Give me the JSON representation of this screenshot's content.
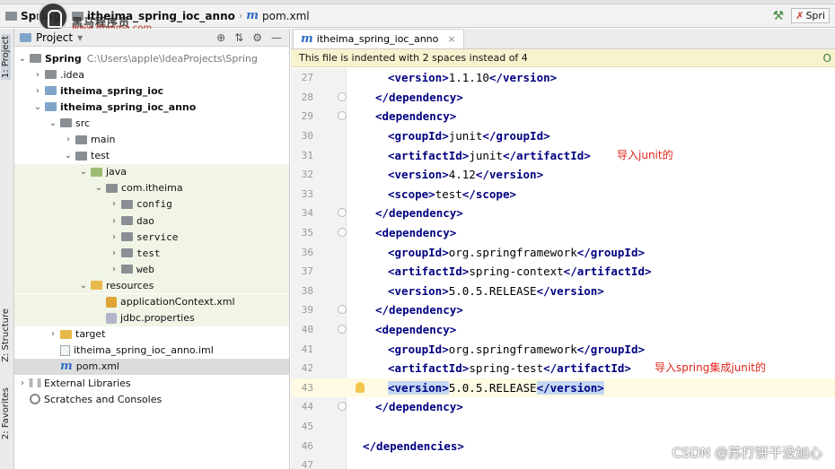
{
  "breadcrumb": {
    "items": [
      "Spring",
      "itheima_spring_ioc_anno",
      "pom.xml"
    ]
  },
  "logo": {
    "name": "黑马程序员",
    "url": "www.itheima.com"
  },
  "run_config": {
    "label": "Spri"
  },
  "left_strip": {
    "tabs": [
      "1: Project",
      "Z: Structure",
      "2: Favorites"
    ]
  },
  "project_panel": {
    "title": "Project",
    "tree": [
      {
        "label": "Spring",
        "extra": "C:\\Users\\apple\\IdeaProjects\\Spring",
        "bold": true,
        "depth": 0,
        "expanded": true,
        "icon": "folder-icon"
      },
      {
        "label": ".idea",
        "depth": 1,
        "expanded": false,
        "icon": "folder-icon"
      },
      {
        "label": "itheima_spring_ioc",
        "bold": true,
        "depth": 1,
        "expanded": false,
        "icon": "module-folder-icon"
      },
      {
        "label": "itheima_spring_ioc_anno",
        "bold": true,
        "depth": 1,
        "expanded": true,
        "icon": "module-folder-icon"
      },
      {
        "label": "src",
        "depth": 2,
        "expanded": true,
        "icon": "folder-icon"
      },
      {
        "label": "main",
        "depth": 3,
        "expanded": false,
        "icon": "folder-icon"
      },
      {
        "label": "test",
        "depth": 3,
        "expanded": true,
        "icon": "folder-icon"
      },
      {
        "label": "java",
        "depth": 4,
        "expanded": true,
        "icon": "test-source-folder-icon",
        "hl": true
      },
      {
        "label": "com.itheima",
        "depth": 5,
        "expanded": true,
        "icon": "package-icon",
        "hl": true
      },
      {
        "label": "config",
        "depth": 6,
        "expanded": false,
        "icon": "package-icon",
        "hl": true
      },
      {
        "label": "dao",
        "depth": 6,
        "expanded": false,
        "icon": "package-icon",
        "hl": true
      },
      {
        "label": "service",
        "depth": 6,
        "expanded": false,
        "icon": "package-icon",
        "hl": true
      },
      {
        "label": "test",
        "depth": 6,
        "expanded": false,
        "icon": "package-icon",
        "hl": true
      },
      {
        "label": "web",
        "depth": 6,
        "expanded": false,
        "icon": "package-icon",
        "hl": true
      },
      {
        "label": "resources",
        "depth": 4,
        "expanded": true,
        "icon": "resources-folder-icon",
        "hl": true
      },
      {
        "label": "applicationContext.xml",
        "depth": 5,
        "icon": "xml-file-icon",
        "hl": true
      },
      {
        "label": "jdbc.properties",
        "depth": 5,
        "icon": "properties-file-icon",
        "hl": true
      },
      {
        "label": "target",
        "depth": 2,
        "expanded": false,
        "icon": "target-folder-icon"
      },
      {
        "label": "itheima_spring_ioc_anno.iml",
        "depth": 2,
        "icon": "iml-file-icon"
      },
      {
        "label": "pom.xml",
        "depth": 2,
        "icon": "maven-file-icon",
        "selected": true
      },
      {
        "label": "External Libraries",
        "depth": 0,
        "expanded": false,
        "icon": "library-icon"
      },
      {
        "label": "Scratches and Consoles",
        "depth": 0,
        "icon": "scratch-icon"
      }
    ]
  },
  "editor": {
    "tab": {
      "label": "itheima_spring_ioc_anno"
    },
    "notice": {
      "text": "This file is indented with 2 spaces instead of 4",
      "option": "O"
    },
    "lines": [
      {
        "n": "27",
        "indent": 1,
        "parts": [
          [
            "t",
            "<version>"
          ],
          [
            "x",
            "1.1.10"
          ],
          [
            "t",
            "</version>"
          ]
        ]
      },
      {
        "n": "28",
        "indent": 0,
        "parts": [
          [
            "t",
            "</dependency>"
          ]
        ]
      },
      {
        "n": "29",
        "indent": 0,
        "parts": [
          [
            "t",
            "<dependency>"
          ]
        ]
      },
      {
        "n": "30",
        "indent": 1,
        "parts": [
          [
            "t",
            "<groupId>"
          ],
          [
            "x",
            "junit"
          ],
          [
            "t",
            "</groupId>"
          ]
        ]
      },
      {
        "n": "31",
        "indent": 1,
        "parts": [
          [
            "t",
            "<artifactId>"
          ],
          [
            "x",
            "junit"
          ],
          [
            "t",
            "</artifactId>"
          ]
        ]
      },
      {
        "n": "32",
        "indent": 1,
        "parts": [
          [
            "t",
            "<version>"
          ],
          [
            "x",
            "4.12"
          ],
          [
            "t",
            "</version>"
          ]
        ]
      },
      {
        "n": "33",
        "indent": 1,
        "parts": [
          [
            "t",
            "<scope>"
          ],
          [
            "x",
            "test"
          ],
          [
            "t",
            "</scope>"
          ]
        ]
      },
      {
        "n": "34",
        "indent": 0,
        "parts": [
          [
            "t",
            "</dependency>"
          ]
        ]
      },
      {
        "n": "35",
        "indent": 0,
        "parts": [
          [
            "t",
            "<dependency>"
          ]
        ]
      },
      {
        "n": "36",
        "indent": 1,
        "parts": [
          [
            "t",
            "<groupId>"
          ],
          [
            "x",
            "org.springframework"
          ],
          [
            "t",
            "</groupId>"
          ]
        ]
      },
      {
        "n": "37",
        "indent": 1,
        "parts": [
          [
            "t",
            "<artifactId>"
          ],
          [
            "x",
            "spring-context"
          ],
          [
            "t",
            "</artifactId>"
          ]
        ]
      },
      {
        "n": "38",
        "indent": 1,
        "parts": [
          [
            "t",
            "<version>"
          ],
          [
            "x",
            "5.0.5.RELEASE"
          ],
          [
            "t",
            "</version>"
          ]
        ]
      },
      {
        "n": "39",
        "indent": 0,
        "parts": [
          [
            "t",
            "</dependency>"
          ]
        ]
      },
      {
        "n": "40",
        "indent": 0,
        "parts": [
          [
            "t",
            "<dependency>"
          ]
        ]
      },
      {
        "n": "41",
        "indent": 1,
        "parts": [
          [
            "t",
            "<groupId>"
          ],
          [
            "x",
            "org.springframework"
          ],
          [
            "t",
            "</groupId>"
          ]
        ]
      },
      {
        "n": "42",
        "indent": 1,
        "parts": [
          [
            "t",
            "<artifactId>"
          ],
          [
            "x",
            "spring-test"
          ],
          [
            "t",
            "</artifactId>"
          ]
        ]
      },
      {
        "n": "43",
        "indent": 1,
        "current": true,
        "parts": [
          [
            "s",
            "<version>"
          ],
          [
            "x",
            "5.0.5.RELEASE"
          ],
          [
            "s",
            "</version>"
          ]
        ]
      },
      {
        "n": "44",
        "indent": 0,
        "parts": [
          [
            "t",
            "</dependency>"
          ]
        ]
      },
      {
        "n": "45",
        "indent": -1,
        "parts": []
      },
      {
        "n": "46",
        "indent": -1,
        "parts": [
          [
            "t",
            "</dependencies>"
          ]
        ]
      },
      {
        "n": "47",
        "indent": -1,
        "parts": []
      }
    ],
    "annotations": {
      "junit": "导入junit的",
      "spring_test": "导入spring集成junit的"
    }
  },
  "watermark": "CSDN @苏打饼干没加心"
}
